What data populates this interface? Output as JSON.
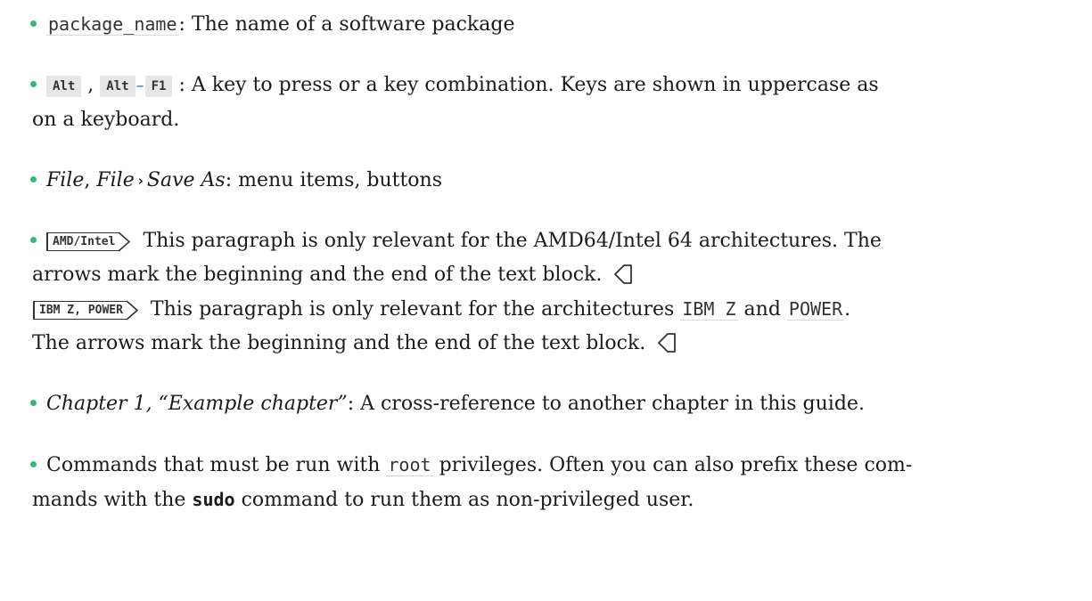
{
  "item_package": {
    "code": "package_name",
    "text": ": The name of a software package"
  },
  "item_keys": {
    "key1": "Alt",
    "comma": ",",
    "key2": "Alt",
    "dash": "–",
    "key3": "F1",
    "text_line1": ": A key to press or a key combination. Keys are shown in uppercase as",
    "text_line2": "on a keyboard."
  },
  "item_menu": {
    "file1": "File",
    "comma": ", ",
    "file2": "File",
    "sep": "›",
    "save_as": "Save As",
    "text": ": menu items, buttons"
  },
  "item_arch": {
    "tag1": "AMD/Intel",
    "text1_line1": "This paragraph is only relevant for the AMD64/Intel 64 architectures. The",
    "text1_line2": "arrows mark the beginning and the end of the text block.",
    "tag2": "IBM Z, POWER",
    "text2_part1": "This paragraph is only relevant for the architectures",
    "code_ibmz": "IBM Z",
    "and": "and",
    "code_power": "POWER",
    "period": ".",
    "text2_line2": "The arrows mark the beginning and the end of the text block."
  },
  "item_xref": {
    "link": "Chapter 1, “Example chapter”",
    "text": ": A cross-reference to another chapter in this guide."
  },
  "item_root": {
    "text1": "Commands that must be run with",
    "code_root": "root",
    "text2": "privileges. Often you can also prefix these com-",
    "text3": "mands with the",
    "sudo": "sudo",
    "text4": "command to run them as non-privileged user."
  },
  "colors": {
    "bullet": "#30ba78",
    "kbd_background": "#e6e6e6",
    "kbd_separator": "#3070c0"
  },
  "icons": {
    "bullet": "bullet-dot-icon",
    "arch_start": "arch-start-arrow-icon",
    "arch_end": "arch-end-arrow-icon"
  }
}
